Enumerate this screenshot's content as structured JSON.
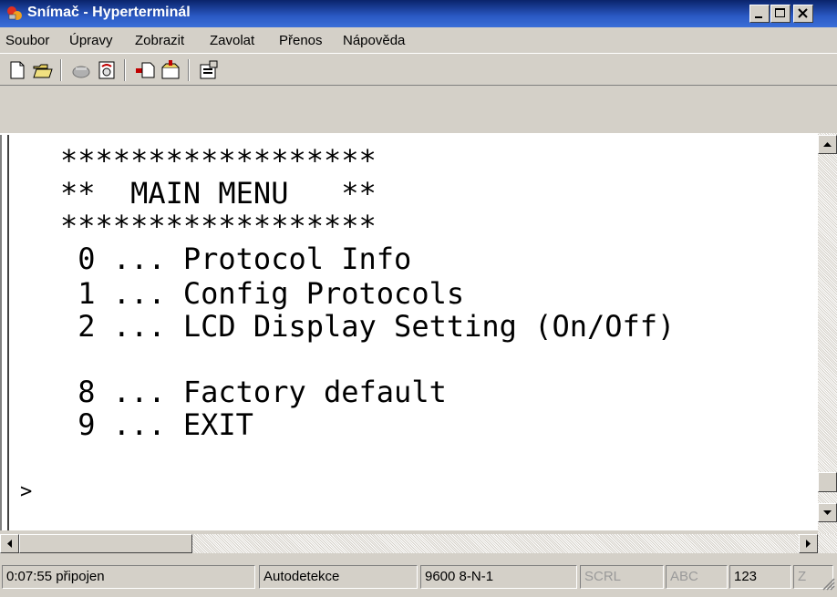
{
  "window": {
    "title": "Snímač - Hyperterminál",
    "controls": [
      "minimize",
      "maximize",
      "close"
    ]
  },
  "menu": [
    "Soubor",
    "Úpravy",
    "Zobrazit",
    "Zavolat",
    "Přenos",
    "Nápověda"
  ],
  "toolbar": {
    "buttons": [
      "new-document-icon",
      "open-folder-icon",
      "disconnect-icon",
      "call-icon",
      "send-icon",
      "receive-icon",
      "properties-icon"
    ]
  },
  "terminal": {
    "lines": [
      "******************",
      "**  MAIN MENU   **",
      "******************",
      " 0 ... Protocol Info",
      " 1 ... Config Protocols",
      " 2 ... LCD Display Setting (On/Off)",
      "",
      " 8 ... Factory default",
      " 9 ... EXIT",
      "",
      ">"
    ]
  },
  "status": {
    "time": "0:07:55 připojen",
    "detect": "Autodetekce",
    "port": "9600 8-N-1",
    "scrl": "SCRL",
    "caps": "ABC",
    "num": "123",
    "z": "Z"
  }
}
